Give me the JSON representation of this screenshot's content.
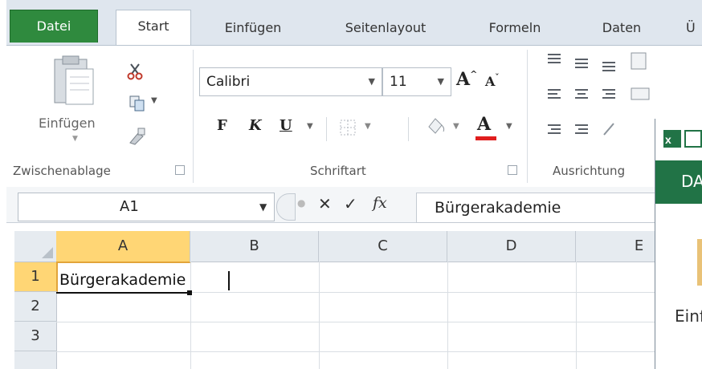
{
  "tabs": {
    "file": "Datei",
    "start": "Start",
    "insert": "Einfügen",
    "layout": "Seitenlayout",
    "formulas": "Formeln",
    "data": "Daten",
    "partial": "Ü"
  },
  "ribbon": {
    "paste_label": "Einfügen",
    "clipboard_label": "Zwischenablage",
    "font_label": "Schriftart",
    "alignment_label": "Ausrichtung",
    "font_name": "Calibri",
    "font_size": "11",
    "bold": "F",
    "italic": "K",
    "underline": "U",
    "font_color": "A"
  },
  "formula_bar": {
    "name_box": "A1",
    "cancel_symbol": "✕",
    "enter_symbol": "✓",
    "fx_symbol": "fx",
    "content": "Bürgerakademie"
  },
  "sheet": {
    "columns": [
      "A",
      "B",
      "C",
      "D",
      "E"
    ],
    "rows": [
      "1",
      "2",
      "3"
    ],
    "cell_a1": "Bürgerakademie"
  },
  "overlay_window": {
    "tab_partial": "DA",
    "paste_partial": "Einf"
  },
  "colors": {
    "file_tab": "#2f8a3e",
    "selected_header": "#ffd675",
    "overlay_header": "#217346"
  }
}
